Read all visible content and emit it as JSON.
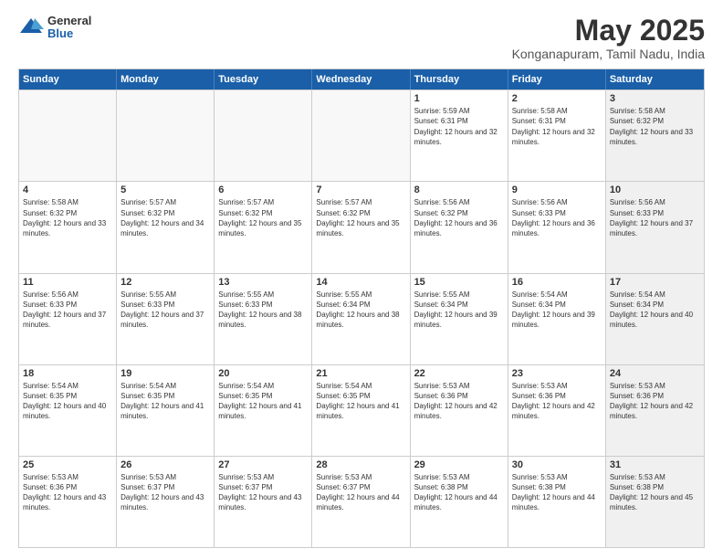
{
  "logo": {
    "general": "General",
    "blue": "Blue"
  },
  "title": "May 2025",
  "subtitle": "Konganapuram, Tamil Nadu, India",
  "header_days": [
    "Sunday",
    "Monday",
    "Tuesday",
    "Wednesday",
    "Thursday",
    "Friday",
    "Saturday"
  ],
  "rows": [
    [
      {
        "day": "",
        "empty": true
      },
      {
        "day": "",
        "empty": true
      },
      {
        "day": "",
        "empty": true
      },
      {
        "day": "",
        "empty": true
      },
      {
        "day": "1",
        "sunrise": "5:59 AM",
        "sunset": "6:31 PM",
        "daylight": "12 hours and 32 minutes."
      },
      {
        "day": "2",
        "sunrise": "5:58 AM",
        "sunset": "6:31 PM",
        "daylight": "12 hours and 32 minutes."
      },
      {
        "day": "3",
        "sunrise": "5:58 AM",
        "sunset": "6:32 PM",
        "daylight": "12 hours and 33 minutes.",
        "shaded": true
      }
    ],
    [
      {
        "day": "4",
        "sunrise": "5:58 AM",
        "sunset": "6:32 PM",
        "daylight": "12 hours and 33 minutes."
      },
      {
        "day": "5",
        "sunrise": "5:57 AM",
        "sunset": "6:32 PM",
        "daylight": "12 hours and 34 minutes."
      },
      {
        "day": "6",
        "sunrise": "5:57 AM",
        "sunset": "6:32 PM",
        "daylight": "12 hours and 35 minutes."
      },
      {
        "day": "7",
        "sunrise": "5:57 AM",
        "sunset": "6:32 PM",
        "daylight": "12 hours and 35 minutes."
      },
      {
        "day": "8",
        "sunrise": "5:56 AM",
        "sunset": "6:32 PM",
        "daylight": "12 hours and 36 minutes."
      },
      {
        "day": "9",
        "sunrise": "5:56 AM",
        "sunset": "6:33 PM",
        "daylight": "12 hours and 36 minutes."
      },
      {
        "day": "10",
        "sunrise": "5:56 AM",
        "sunset": "6:33 PM",
        "daylight": "12 hours and 37 minutes.",
        "shaded": true
      }
    ],
    [
      {
        "day": "11",
        "sunrise": "5:56 AM",
        "sunset": "6:33 PM",
        "daylight": "12 hours and 37 minutes."
      },
      {
        "day": "12",
        "sunrise": "5:55 AM",
        "sunset": "6:33 PM",
        "daylight": "12 hours and 37 minutes."
      },
      {
        "day": "13",
        "sunrise": "5:55 AM",
        "sunset": "6:33 PM",
        "daylight": "12 hours and 38 minutes."
      },
      {
        "day": "14",
        "sunrise": "5:55 AM",
        "sunset": "6:34 PM",
        "daylight": "12 hours and 38 minutes."
      },
      {
        "day": "15",
        "sunrise": "5:55 AM",
        "sunset": "6:34 PM",
        "daylight": "12 hours and 39 minutes."
      },
      {
        "day": "16",
        "sunrise": "5:54 AM",
        "sunset": "6:34 PM",
        "daylight": "12 hours and 39 minutes."
      },
      {
        "day": "17",
        "sunrise": "5:54 AM",
        "sunset": "6:34 PM",
        "daylight": "12 hours and 40 minutes.",
        "shaded": true
      }
    ],
    [
      {
        "day": "18",
        "sunrise": "5:54 AM",
        "sunset": "6:35 PM",
        "daylight": "12 hours and 40 minutes."
      },
      {
        "day": "19",
        "sunrise": "5:54 AM",
        "sunset": "6:35 PM",
        "daylight": "12 hours and 41 minutes."
      },
      {
        "day": "20",
        "sunrise": "5:54 AM",
        "sunset": "6:35 PM",
        "daylight": "12 hours and 41 minutes."
      },
      {
        "day": "21",
        "sunrise": "5:54 AM",
        "sunset": "6:35 PM",
        "daylight": "12 hours and 41 minutes."
      },
      {
        "day": "22",
        "sunrise": "5:53 AM",
        "sunset": "6:36 PM",
        "daylight": "12 hours and 42 minutes."
      },
      {
        "day": "23",
        "sunrise": "5:53 AM",
        "sunset": "6:36 PM",
        "daylight": "12 hours and 42 minutes."
      },
      {
        "day": "24",
        "sunrise": "5:53 AM",
        "sunset": "6:36 PM",
        "daylight": "12 hours and 42 minutes.",
        "shaded": true
      }
    ],
    [
      {
        "day": "25",
        "sunrise": "5:53 AM",
        "sunset": "6:36 PM",
        "daylight": "12 hours and 43 minutes."
      },
      {
        "day": "26",
        "sunrise": "5:53 AM",
        "sunset": "6:37 PM",
        "daylight": "12 hours and 43 minutes."
      },
      {
        "day": "27",
        "sunrise": "5:53 AM",
        "sunset": "6:37 PM",
        "daylight": "12 hours and 43 minutes."
      },
      {
        "day": "28",
        "sunrise": "5:53 AM",
        "sunset": "6:37 PM",
        "daylight": "12 hours and 44 minutes."
      },
      {
        "day": "29",
        "sunrise": "5:53 AM",
        "sunset": "6:38 PM",
        "daylight": "12 hours and 44 minutes."
      },
      {
        "day": "30",
        "sunrise": "5:53 AM",
        "sunset": "6:38 PM",
        "daylight": "12 hours and 44 minutes."
      },
      {
        "day": "31",
        "sunrise": "5:53 AM",
        "sunset": "6:38 PM",
        "daylight": "12 hours and 45 minutes.",
        "shaded": true
      }
    ]
  ]
}
